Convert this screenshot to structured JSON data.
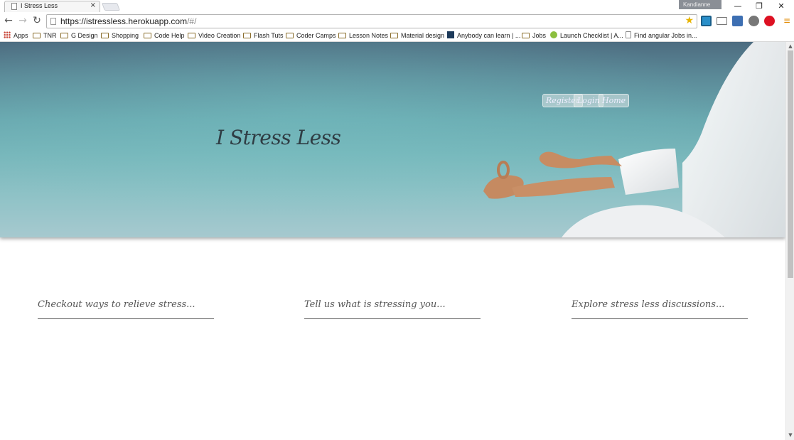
{
  "browser": {
    "tab_title": "I Stress Less",
    "tab_close": "×",
    "user_name": "Kandianne",
    "url_main": "https://istressless.herokuapp.com",
    "url_rest": "/#/",
    "window_min": "—",
    "window_restore": "❐",
    "window_close": "✕"
  },
  "bookmarks": [
    {
      "label": "Apps"
    },
    {
      "label": "TNR"
    },
    {
      "label": "G Design"
    },
    {
      "label": "Shopping"
    },
    {
      "label": "Code Help"
    },
    {
      "label": "Video Creation"
    },
    {
      "label": "Flash Tuts"
    },
    {
      "label": "Coder Camps"
    },
    {
      "label": "Lesson Notes"
    },
    {
      "label": "Material design"
    },
    {
      "label": "Anybody can learn | ..."
    },
    {
      "label": "Jobs"
    },
    {
      "label": "Launch Checklist | A..."
    },
    {
      "label": "Find angular Jobs in..."
    }
  ],
  "site": {
    "nav": {
      "register": "Register",
      "login": "Login",
      "home": "Home"
    },
    "title": "I Stress Less",
    "columns": [
      {
        "label": "Checkout ways to relieve stress..."
      },
      {
        "label": "Tell us what is stressing you..."
      },
      {
        "label": "Explore stress less discussions..."
      }
    ]
  },
  "colors": {
    "hero_top": "#4d6c80",
    "hero_bottom": "#a6c9cf",
    "title_text": "#2f3d44"
  }
}
